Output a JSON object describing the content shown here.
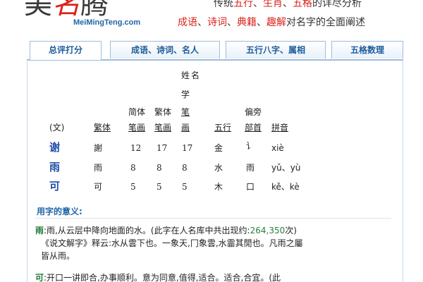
{
  "header": {
    "logo_chars": [
      "美",
      "名",
      "腾"
    ],
    "domain": "MeiMingTeng.com",
    "slogan1_parts": [
      "传统",
      "五行",
      "、",
      "生肖",
      "、",
      "五格",
      "的详尽分析"
    ],
    "slogan2_parts": [
      "成语",
      "、",
      "诗词",
      "、",
      "典籍",
      "、",
      "趣解",
      "对名字的全面阐述"
    ]
  },
  "tabs": [
    {
      "label": "总评打分",
      "active": true
    },
    {
      "label": "成语、诗词、名人",
      "active": false
    },
    {
      "label": "五行八字、属相",
      "active": false
    },
    {
      "label": "五格数理",
      "active": false
    }
  ],
  "table": {
    "col_headers": {
      "wen": "(文)",
      "fanti": "繁体",
      "jianti": [
        "简体",
        "笔画"
      ],
      "fanti_strokes": [
        "繁体",
        "笔画"
      ],
      "xingming": [
        "姓",
        "名",
        "学",
        "笔",
        "画"
      ],
      "wuxing": "五行",
      "bushou": [
        "偏旁",
        "部首"
      ],
      "pinyin": "拼音"
    },
    "rows": [
      {
        "char": "谢",
        "fanti": "謝",
        "jianti": "12",
        "fanti_strokes": "17",
        "xingming": "17",
        "wuxing": "金",
        "bushou": "讠",
        "pinyin": "xiè"
      },
      {
        "char": "雨",
        "fanti": "雨",
        "jianti": "8",
        "fanti_strokes": "8",
        "xingming": "8",
        "wuxing": "水",
        "bushou": "雨",
        "pinyin": "yǔ、yù"
      },
      {
        "char": "可",
        "fanti": "可",
        "jianti": "5",
        "fanti_strokes": "5",
        "xingming": "5",
        "wuxing": "木",
        "bushou": "口",
        "pinyin": "kě、kè"
      }
    ]
  },
  "meaning": {
    "title": "用字的意义:",
    "p1_head": "雨",
    "p1_line1_a": ":雨,从云层中降向地面的水。(此字在人名库中共出现约:",
    "p1_count": "264,350",
    "p1_line1_b": "次)",
    "p1_line2": "《说文解字》释云:水从雲下也。一象天,冂象雲,水霝其閒也。凡雨之屬",
    "p1_line3": "皆从雨。",
    "p2_head": "可",
    "p2_line1": ":开口一讲即合,办事顺利。意为同意,值得,适合。适合,合宜。(此"
  },
  "colors": {
    "brand_blue": "#1f64a8",
    "accent_red": "#d9231b",
    "name_blue": "#1f4fa8",
    "count_green": "#2a7f3c"
  }
}
